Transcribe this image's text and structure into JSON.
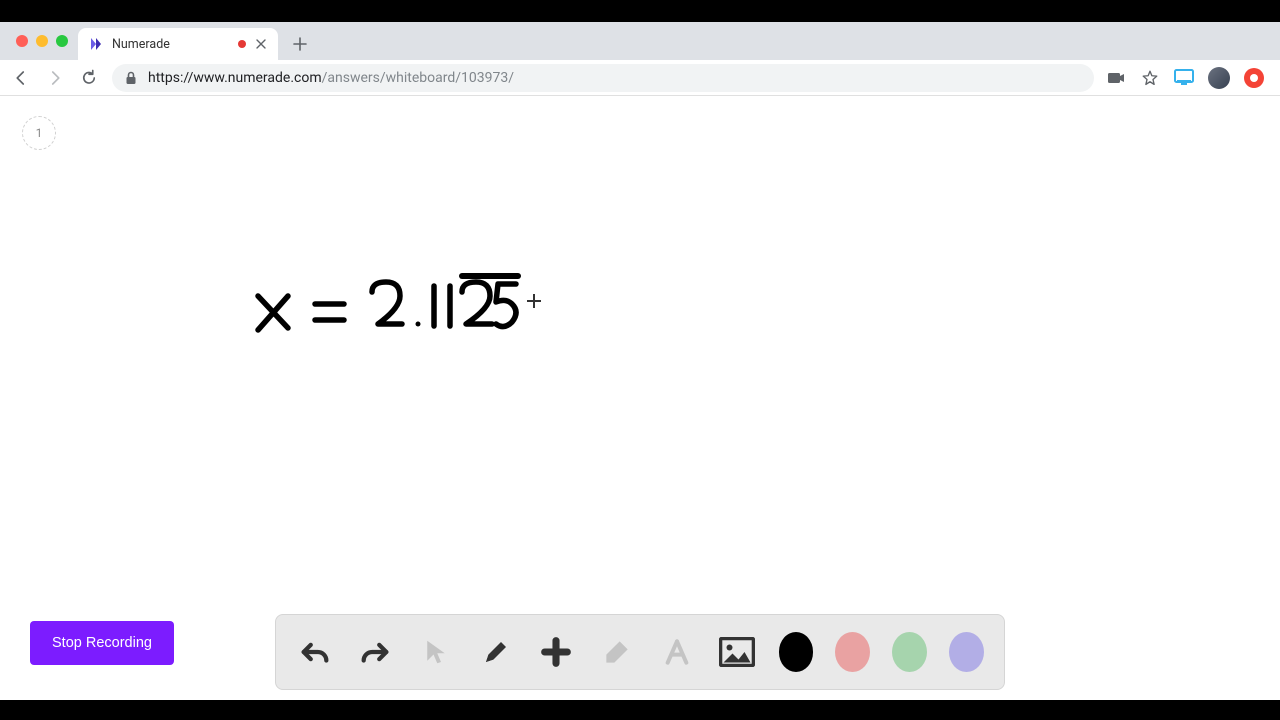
{
  "window": {
    "tab": {
      "title": "Numerade",
      "recording": true
    },
    "url_host": "https://www.numerade.com",
    "url_path": "/answers/whiteboard/103973/"
  },
  "page": {
    "counter": "1",
    "handwriting_expression": "x = 2.1125 (with bar over 25)",
    "stop_recording_label": "Stop Recording"
  },
  "tools": {
    "undo": "undo",
    "redo": "redo",
    "pointer": "pointer",
    "pen": "pen",
    "shape": "shape",
    "eraser": "eraser",
    "text": "text",
    "image": "image"
  },
  "colors": {
    "black": "#000000",
    "pink": "#e9a2a2",
    "green": "#a6d4ad",
    "purple": "#b2aee6"
  }
}
